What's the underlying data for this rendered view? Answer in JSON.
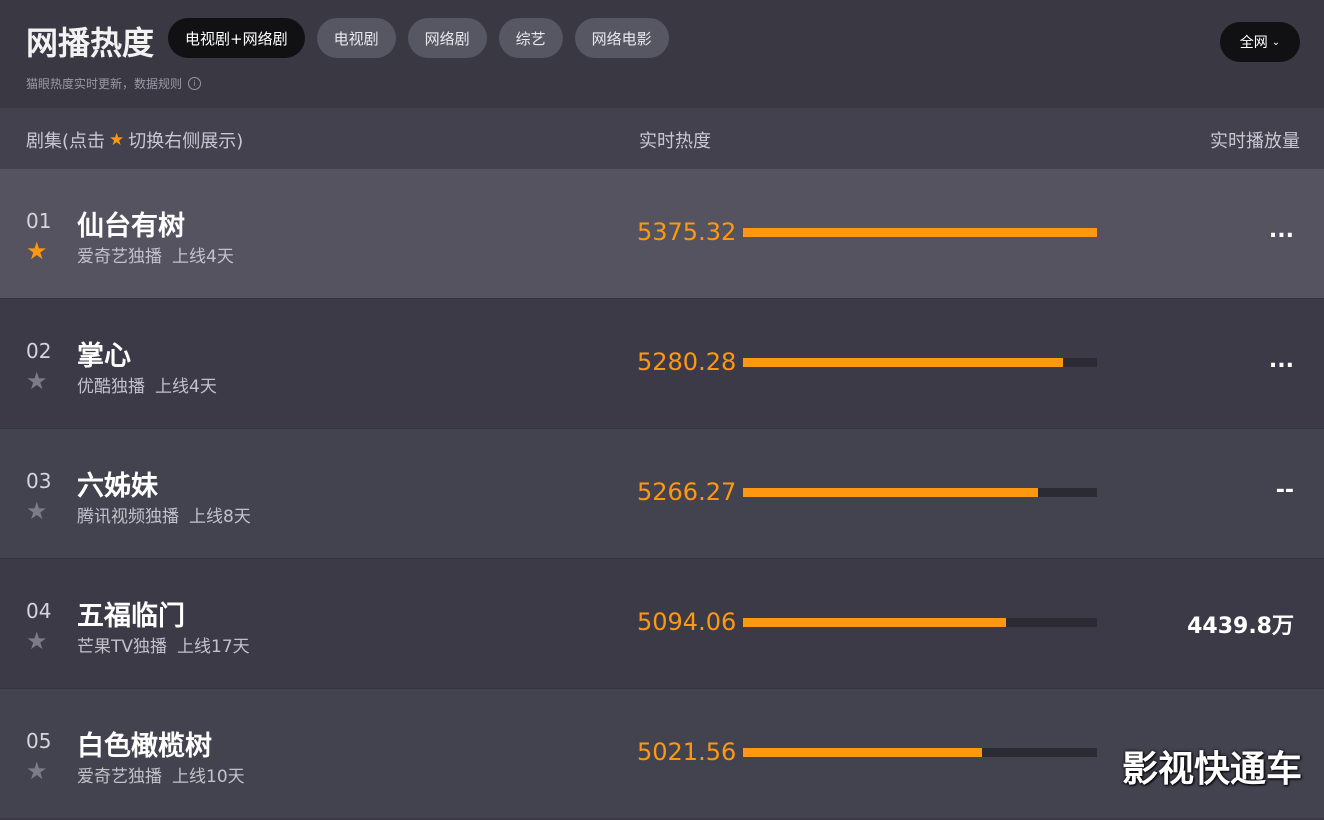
{
  "header": {
    "title": "网播热度",
    "tabs": [
      "电视剧+网络剧",
      "电视剧",
      "网络剧",
      "综艺",
      "网络电影"
    ],
    "scope": "全网",
    "subtitle": "猫眼热度实时更新，数据规则"
  },
  "columns": {
    "title_prefix": "剧集(点击",
    "title_suffix": "切换右侧展示)",
    "heat": "实时热度",
    "plays": "实时播放量"
  },
  "rows": [
    {
      "rank": "01",
      "name": "仙台有树",
      "platform": "爱奇艺独播",
      "online": "上线4天",
      "heat": "5375.32",
      "heat_fraction": 1.0,
      "plays": "...",
      "starred": true
    },
    {
      "rank": "02",
      "name": "掌心",
      "platform": "优酷独播",
      "online": "上线4天",
      "heat": "5280.28",
      "heat_fraction": 0.905,
      "plays": "...",
      "starred": false
    },
    {
      "rank": "03",
      "name": "六姊妹",
      "platform": "腾讯视频独播",
      "online": "上线8天",
      "heat": "5266.27",
      "heat_fraction": 0.833,
      "plays": "--",
      "starred": false
    },
    {
      "rank": "04",
      "name": "五福临门",
      "platform": "芒果TV独播",
      "online": "上线17天",
      "heat": "5094.06",
      "heat_fraction": 0.742,
      "plays": "4439.8万",
      "starred": false
    },
    {
      "rank": "05",
      "name": "白色橄榄树",
      "platform": "爱奇艺独播",
      "online": "上线10天",
      "heat": "5021.56",
      "heat_fraction": 0.675,
      "plays": "",
      "starred": false
    }
  ],
  "watermark": "影视快通车",
  "colors": {
    "accent": "#ff9811",
    "bg": "#3b3a46"
  }
}
